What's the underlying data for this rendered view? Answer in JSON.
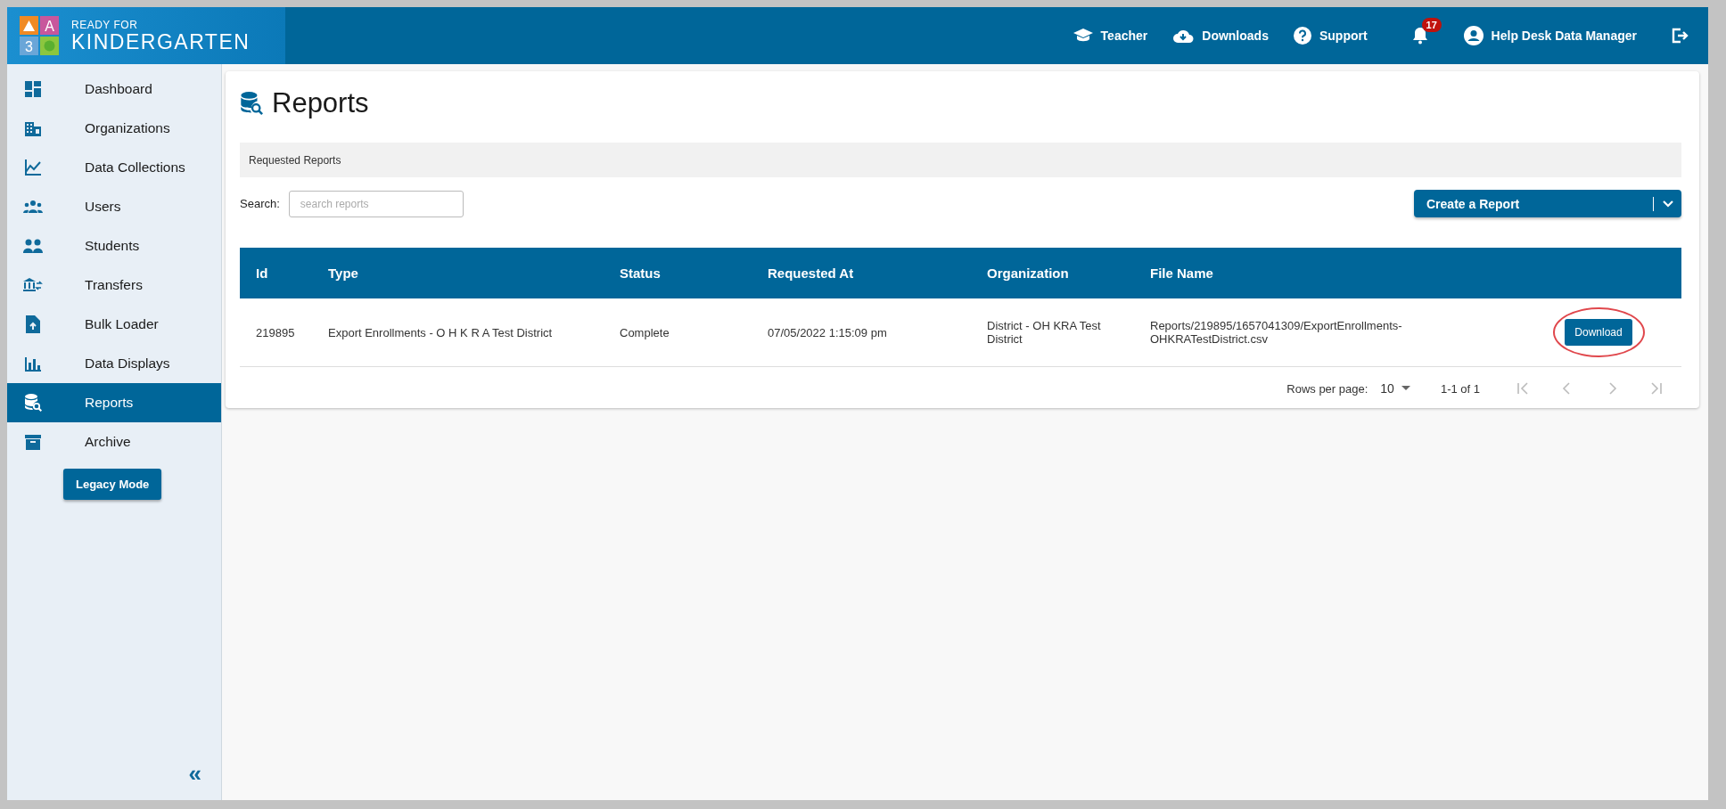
{
  "brand": {
    "line_1": "READY FOR",
    "line_2": "KINDERGARTEN",
    "logo_letters": [
      "A",
      "3"
    ]
  },
  "top_nav": [
    {
      "kind": "teacher",
      "label": "Teacher"
    },
    {
      "kind": "downloads",
      "label": "Downloads"
    },
    {
      "kind": "support",
      "label": "Support"
    }
  ],
  "notifications": {
    "count": "17"
  },
  "user": {
    "name": "Help Desk Data Manager"
  },
  "sidebar": {
    "items": [
      {
        "kind": "dashboard",
        "label": "Dashboard",
        "selected": false
      },
      {
        "kind": "organizations",
        "label": "Organizations",
        "selected": false
      },
      {
        "kind": "collections",
        "label": "Data Collections",
        "selected": false
      },
      {
        "kind": "users",
        "label": "Users",
        "selected": false
      },
      {
        "kind": "students",
        "label": "Students",
        "selected": false
      },
      {
        "kind": "transfers",
        "label": "Transfers",
        "selected": false
      },
      {
        "kind": "bulk",
        "label": "Bulk Loader",
        "selected": false
      },
      {
        "kind": "displays",
        "label": "Data Displays",
        "selected": false
      },
      {
        "kind": "reports",
        "label": "Reports",
        "selected": true
      },
      {
        "kind": "archive",
        "label": "Archive",
        "selected": false
      }
    ],
    "legacy_button": "Legacy Mode",
    "collapse": "«"
  },
  "page": {
    "title": "Reports",
    "section": "Requested Reports",
    "search_label": "Search:",
    "search_placeholder": "search reports",
    "create_button": "Create a Report"
  },
  "table": {
    "columns": [
      "Id",
      "Type",
      "Status",
      "Requested At",
      "Organization",
      "File Name"
    ],
    "rows": [
      {
        "cells": [
          "219895",
          "Export Enrollments - O H K R A Test District",
          "Complete",
          "07/05/2022 1:15:09 pm",
          "District - OH KRA Test District",
          "Reports/219895/1657041309/ExportEnrollments-OHKRATestDistrict.csv"
        ],
        "action": "Download",
        "highlighted": true
      }
    ]
  },
  "pagination": {
    "rows_per_page_label": "Rows per page:",
    "rows_per_page": "10",
    "range": "1-1 of 1"
  }
}
